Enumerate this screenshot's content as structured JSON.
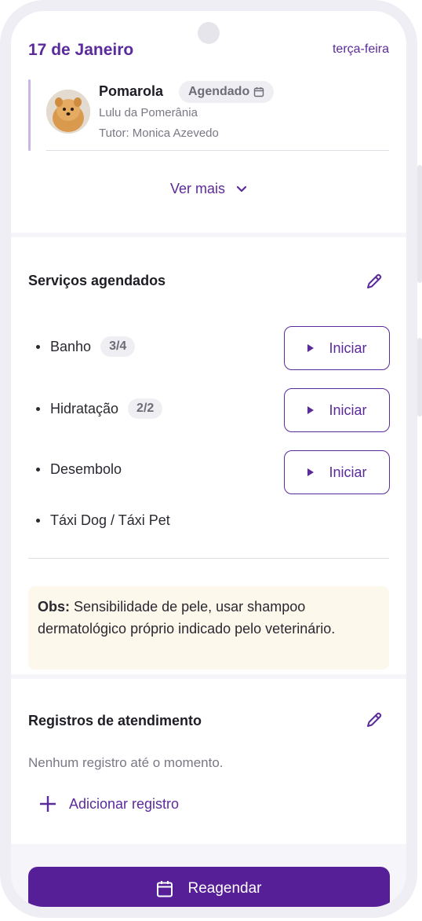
{
  "header": {
    "date": "17 de Janeiro",
    "weekday": "terça-feira"
  },
  "pet": {
    "name": "Pomarola",
    "status": "Agendado",
    "breed": "Lulu da Pomerânia",
    "tutor": "Tutor: Monica Azevedo"
  },
  "ver_mais": "Ver mais",
  "services": {
    "title": "Serviços agendados",
    "items": [
      {
        "label": "Banho",
        "count": "3/4",
        "action": "Iniciar"
      },
      {
        "label": "Hidratação",
        "count": "2/2",
        "action": "Iniciar"
      },
      {
        "label": "Desembolo",
        "count": "",
        "action": "Iniciar"
      },
      {
        "label": "Táxi Dog / Táxi Pet",
        "count": "",
        "action": ""
      }
    ],
    "obs_label": "Obs:",
    "obs_text": "Sensibilidade de pele, usar shampoo dermatológico próprio indicado pelo veterinário."
  },
  "records": {
    "title": "Registros de atendimento",
    "empty": "Nenhum registro até o momento.",
    "add": "Adicionar registro"
  },
  "reschedule": "Reagendar",
  "colors": {
    "accent": "#5b2a9b",
    "button_fill": "#561f98",
    "obs_bg": "#fdf8ec"
  }
}
